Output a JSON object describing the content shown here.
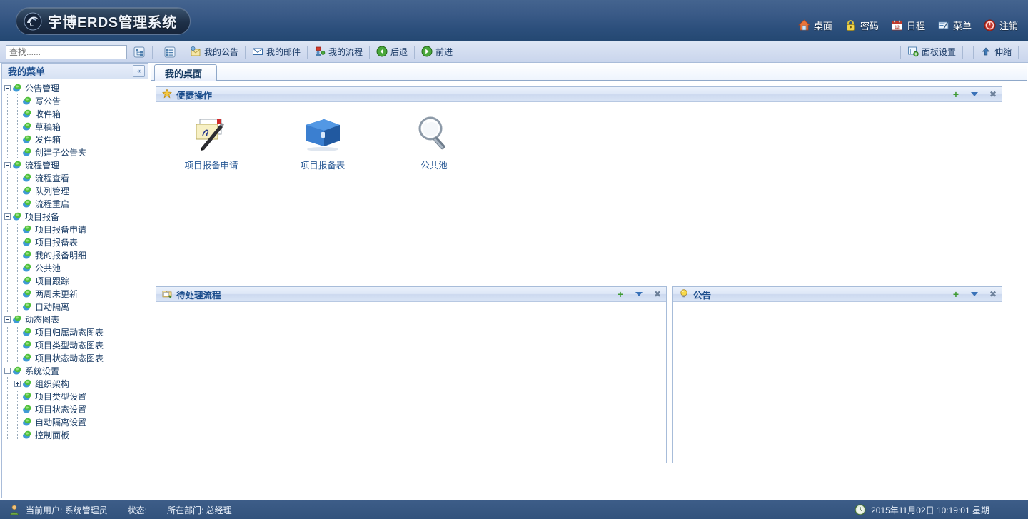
{
  "header": {
    "app_title": "宇博ERDS管理系统",
    "logo_icon": "swirl-logo-icon",
    "nav": [
      {
        "label": "桌面",
        "icon": "home-icon"
      },
      {
        "label": "密码",
        "icon": "lock-icon"
      },
      {
        "label": "日程",
        "icon": "calendar-icon"
      },
      {
        "label": "菜单",
        "icon": "menu-icon"
      },
      {
        "label": "注销",
        "icon": "power-icon"
      }
    ]
  },
  "toolbar": {
    "search_placeholder": "查找......",
    "search_value": "",
    "icon_buttons": [
      {
        "name": "tree-view-icon"
      },
      {
        "name": "list-view-icon"
      }
    ],
    "items": [
      {
        "label": "我的公告",
        "icon": "announcement-icon"
      },
      {
        "label": "我的邮件",
        "icon": "mail-icon"
      },
      {
        "label": "我的流程",
        "icon": "workflow-icon"
      },
      {
        "label": "后退",
        "icon": "back-arrow-icon"
      },
      {
        "label": "前进",
        "icon": "forward-arrow-icon"
      }
    ],
    "right_items": [
      {
        "label": "面板设置",
        "icon": "panel-settings-icon"
      },
      {
        "label": "伸缩",
        "icon": "collapse-up-icon"
      }
    ]
  },
  "sidebar": {
    "title": "我的菜单",
    "collapse_icon": "double-chevron-left-icon",
    "tree": [
      {
        "label": "公告管理",
        "level": 0,
        "toggle": "minus"
      },
      {
        "label": "写公告",
        "level": 1,
        "toggle": "none"
      },
      {
        "label": "收件箱",
        "level": 1,
        "toggle": "none"
      },
      {
        "label": "草稿箱",
        "level": 1,
        "toggle": "none"
      },
      {
        "label": "发件箱",
        "level": 1,
        "toggle": "none"
      },
      {
        "label": "创建子公告夹",
        "level": 1,
        "toggle": "none"
      },
      {
        "label": "流程管理",
        "level": 0,
        "toggle": "minus"
      },
      {
        "label": "流程查看",
        "level": 1,
        "toggle": "none"
      },
      {
        "label": "队列管理",
        "level": 1,
        "toggle": "none"
      },
      {
        "label": "流程重启",
        "level": 1,
        "toggle": "none"
      },
      {
        "label": "项目报备",
        "level": 0,
        "toggle": "minus"
      },
      {
        "label": "项目报备申请",
        "level": 1,
        "toggle": "none"
      },
      {
        "label": "项目报备表",
        "level": 1,
        "toggle": "none"
      },
      {
        "label": "我的报备明细",
        "level": 1,
        "toggle": "none"
      },
      {
        "label": "公共池",
        "level": 1,
        "toggle": "none"
      },
      {
        "label": "项目跟踪",
        "level": 1,
        "toggle": "none"
      },
      {
        "label": "两周未更新",
        "level": 1,
        "toggle": "none"
      },
      {
        "label": "自动隔离",
        "level": 1,
        "toggle": "none"
      },
      {
        "label": "动态图表",
        "level": 0,
        "toggle": "minus"
      },
      {
        "label": "项目归属动态图表",
        "level": 1,
        "toggle": "none"
      },
      {
        "label": "项目类型动态图表",
        "level": 1,
        "toggle": "none"
      },
      {
        "label": "项目状态动态图表",
        "level": 1,
        "toggle": "none"
      },
      {
        "label": "系统设置",
        "level": 0,
        "toggle": "minus"
      },
      {
        "label": "组织架构",
        "level": 1,
        "toggle": "plus"
      },
      {
        "label": "项目类型设置",
        "level": 1,
        "toggle": "none"
      },
      {
        "label": "项目状态设置",
        "level": 1,
        "toggle": "none"
      },
      {
        "label": "自动隔离设置",
        "level": 1,
        "toggle": "none"
      },
      {
        "label": "控制面板",
        "level": 1,
        "toggle": "none"
      }
    ]
  },
  "main": {
    "tabs": [
      {
        "label": "我的桌面",
        "active": true
      }
    ],
    "panels": {
      "quick": {
        "title": "便捷操作",
        "icon": "star-icon",
        "shortcuts": [
          {
            "label": "项目报备申请",
            "icon": "note-pen-icon"
          },
          {
            "label": "项目报备表",
            "icon": "blue-book-icon"
          },
          {
            "label": "公共池",
            "icon": "magnifier-icon"
          }
        ]
      },
      "pending": {
        "title": "待处理流程",
        "icon": "workflow-folder-icon",
        "body_text": ""
      },
      "notice": {
        "title": "公告",
        "icon": "lightbulb-icon",
        "body_text": ""
      }
    },
    "panel_controls": {
      "add": "+",
      "collapse": "▼",
      "close": "✖"
    }
  },
  "statusbar": {
    "user_icon": "user-icon",
    "current_user": "当前用户: 系统管理员",
    "status": "状态:",
    "department": "所在部门: 总经理",
    "clock_icon": "clock-icon",
    "datetime": "2015年11月02日  10:19:01  星期一"
  },
  "colors": {
    "header_top": "#44648f",
    "header_bottom": "#244872",
    "toolbar_bg": "#d3ddf0",
    "panel_border": "#a7bcd9",
    "title_blue": "#1b4d8c",
    "link_blue": "#2a5a96",
    "status_bg": "#35547f"
  }
}
